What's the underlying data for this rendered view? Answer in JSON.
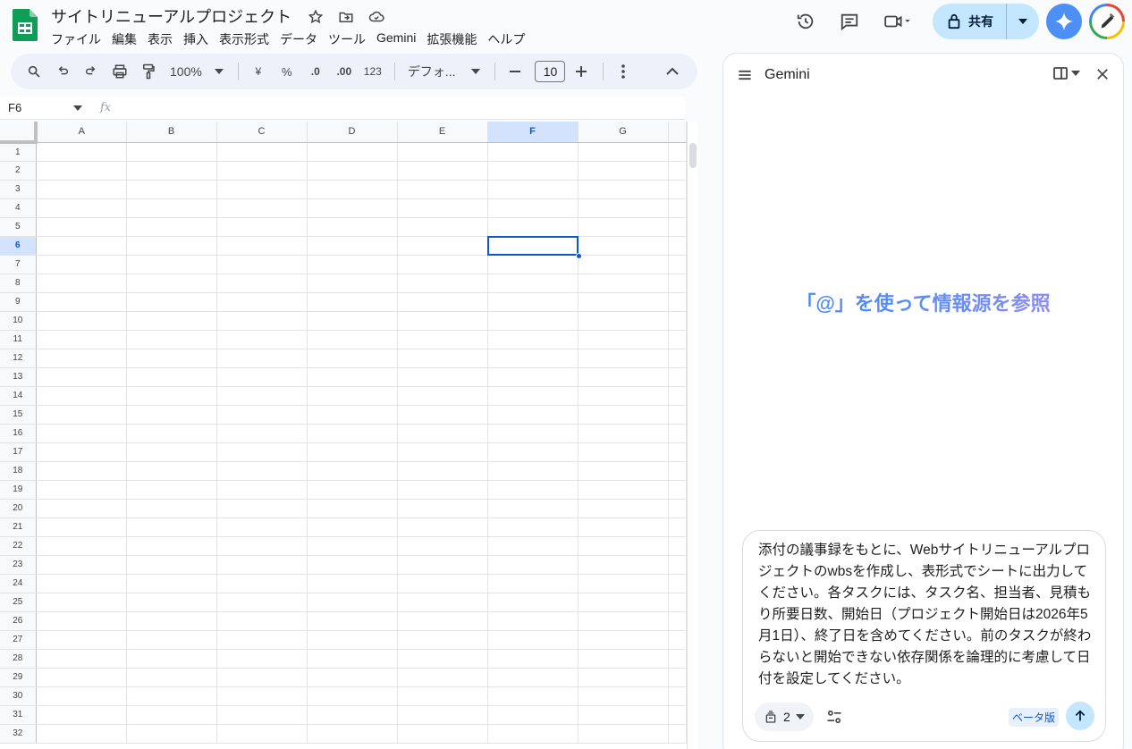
{
  "app": {
    "doc_title": "サイトリニューアルプロジェクト",
    "menu": [
      "ファイル",
      "編集",
      "表示",
      "挿入",
      "表示形式",
      "データ",
      "ツール",
      "Gemini",
      "拡張機能",
      "ヘルプ"
    ],
    "share_label": "共有"
  },
  "toolbar": {
    "zoom": "100%",
    "currency": "¥",
    "percent": "%",
    "decimal_decrease": ".0",
    "decimal_increase": ".00",
    "number_format": "123",
    "font": "デフォ...",
    "font_size": "10"
  },
  "formula_bar": {
    "cell_ref": "F6",
    "fx_label": "fx",
    "value": ""
  },
  "sheet": {
    "columns": [
      "A",
      "B",
      "C",
      "D",
      "E",
      "F",
      "G"
    ],
    "selected_column": "F",
    "selected_row": 6,
    "row_count": 32
  },
  "gemini": {
    "title": "Gemini",
    "hint": "「@」を使って情報源を参照",
    "prompt": "添付の議事録をもとに、Webサイトリニューアルプロジェクトのwbsを作成し、表形式でシートに出力してください。各タスクには、タスク名、担当者、見積もり所要日数、開始日（プロジェクト開始日は2026年5月1日）、終了日を含めてください。前のタスクが終わらないと開始できない依存関係を論理的に考慮して日付を設定してください。",
    "attachments_count": "2",
    "beta_label": "ベータ版"
  },
  "colors": {
    "accent": "#0b57d0",
    "share_bg": "#c2e7ff",
    "toolbar_bg": "#edf2fa",
    "sheets_green": "#0f9d58"
  }
}
